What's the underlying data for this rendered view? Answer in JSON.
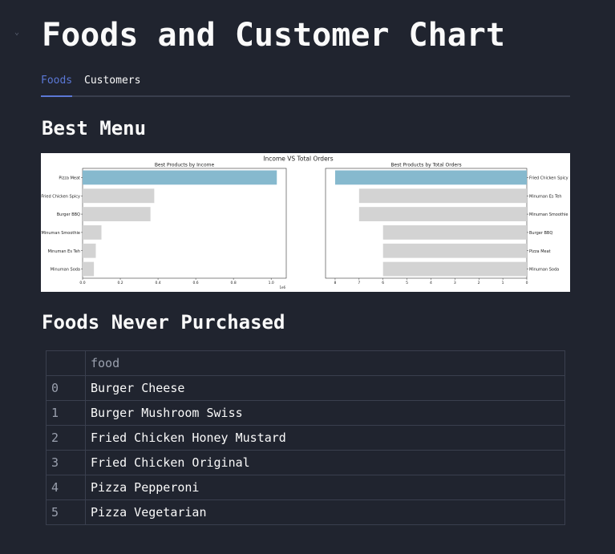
{
  "page": {
    "title": "Foods and Customer Chart",
    "collapse_icon": "chevron-down-icon"
  },
  "tabs": [
    {
      "label": "Foods",
      "active": true
    },
    {
      "label": "Customers",
      "active": false
    }
  ],
  "sections": {
    "best_menu": "Best Menu",
    "never_purchased": "Foods Never Purchased"
  },
  "chart_data": {
    "type": "bar",
    "title": "Income VS Total Orders",
    "subplots": [
      {
        "title": "Best Products by Income",
        "orientation": "horizontal",
        "categories": [
          "Pizza Meat",
          "Fried Chicken Spicy",
          "Burger BBQ",
          "Minuman Smoothie",
          "Minuman Es Teh",
          "Minuman Soda"
        ],
        "values": [
          1.03,
          0.38,
          0.36,
          0.1,
          0.07,
          0.06
        ],
        "xlim": [
          0,
          1.08
        ],
        "xticks": [
          "0.0",
          "0.2",
          "0.4",
          "0.6",
          "0.8",
          "1.0"
        ],
        "x_offset_label": "1e6",
        "highlight_index": 0,
        "highlight_color": "#86b9ce",
        "bar_color": "#d3d3d3"
      },
      {
        "title": "Best Products by Total Orders",
        "orientation": "horizontal",
        "x_inverted": true,
        "y_axis_side": "right",
        "categories": [
          "Fried Chicken Spicy",
          "Minuman Es Teh",
          "Minuman Smoothie",
          "Burger BBQ",
          "Pizza Meat",
          "Minuman Soda"
        ],
        "values": [
          8,
          7,
          7,
          6,
          6,
          6
        ],
        "xlim": [
          8.4,
          0
        ],
        "xticks": [
          "8",
          "7",
          "6",
          "5",
          "4",
          "3",
          "2",
          "1",
          "0"
        ],
        "highlight_index": 0,
        "highlight_color": "#86b9ce",
        "bar_color": "#d3d3d3"
      }
    ]
  },
  "table": {
    "columns": [
      "",
      "food"
    ],
    "rows": [
      {
        "index": "0",
        "food": "Burger Cheese"
      },
      {
        "index": "1",
        "food": "Burger Mushroom Swiss"
      },
      {
        "index": "2",
        "food": "Fried Chicken Honey Mustard"
      },
      {
        "index": "3",
        "food": "Fried Chicken Original"
      },
      {
        "index": "4",
        "food": "Pizza Pepperoni"
      },
      {
        "index": "5",
        "food": "Pizza Vegetarian"
      }
    ]
  }
}
